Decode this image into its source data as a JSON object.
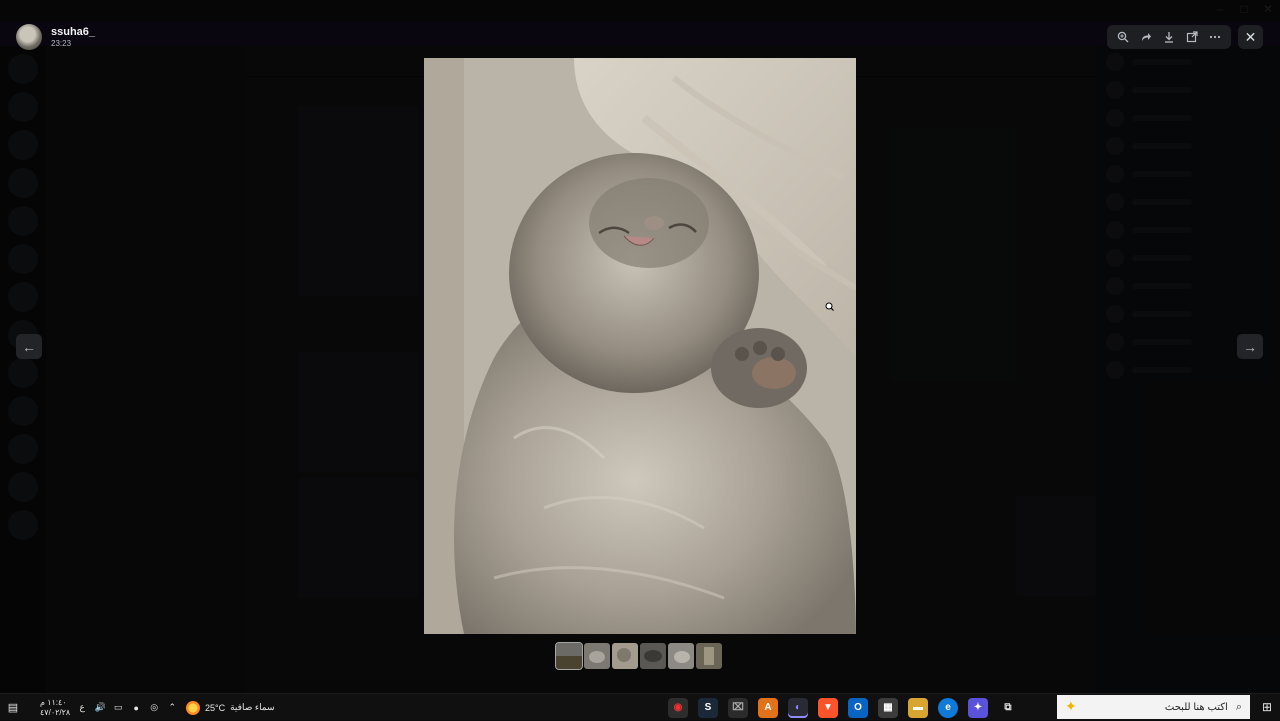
{
  "author": {
    "name": "ssuha6_",
    "time": "23:23"
  },
  "toolbar": {
    "zoom_icon": "zoom-in-icon",
    "forward_icon": "forward-icon",
    "download_icon": "download-icon",
    "open_icon": "open-in-browser-icon",
    "more_icon": "more-icon"
  },
  "thumbnails": {
    "count": 6,
    "active_index": 0
  },
  "taskbar": {
    "time": "١١:٤٠ م",
    "date": "٤٧/٠٢/٢٨",
    "lang": "ع",
    "weather_temp": "25°C",
    "weather_desc": "سماء صافية",
    "search_placeholder": "اكتب هنا للبحث"
  },
  "colors": {
    "overlay": "#000000",
    "panel": "#1e1f22",
    "taskbar": "#101010"
  }
}
